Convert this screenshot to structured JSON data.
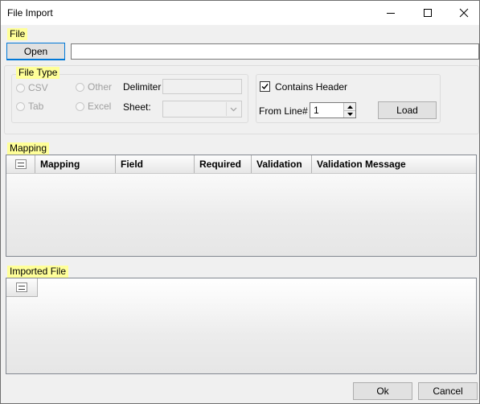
{
  "window": {
    "title": "File Import",
    "minimize_icon": "minimize-icon",
    "maximize_icon": "maximize-icon",
    "close_icon": "close-icon"
  },
  "file_section": {
    "label": "File",
    "open_button": "Open",
    "path_value": ""
  },
  "file_type": {
    "label": "File Type",
    "options": [
      "CSV",
      "Other",
      "Tab",
      "Excel"
    ],
    "delimiter_label": "Delimiter",
    "delimiter_value": "",
    "sheet_label": "Sheet:",
    "sheet_value": ""
  },
  "header_options": {
    "contains_header_label": "Contains Header",
    "contains_header_checked": true,
    "from_line_label": "From Line#",
    "from_line_value": "1",
    "load_button": "Load"
  },
  "mapping": {
    "label": "Mapping",
    "columns": [
      "Mapping",
      "Field",
      "Required",
      "Validation",
      "Validation Message"
    ]
  },
  "imported_file": {
    "label": "Imported File"
  },
  "footer": {
    "ok_button": "Ok",
    "cancel_button": "Cancel"
  }
}
